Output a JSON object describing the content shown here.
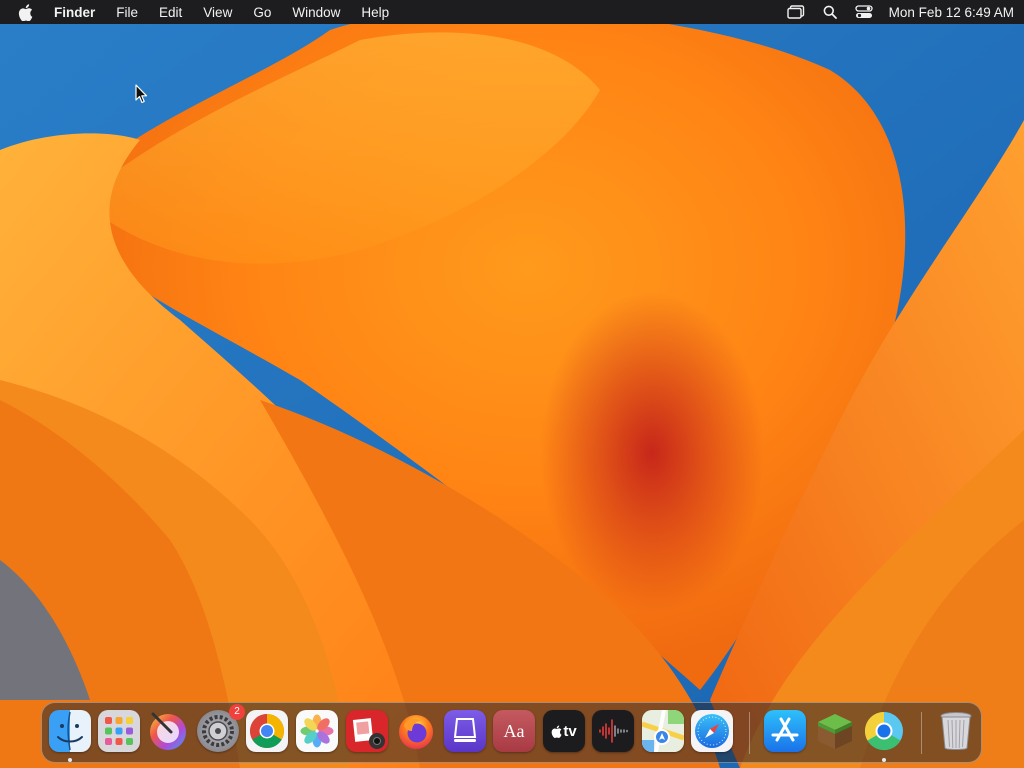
{
  "menubar": {
    "apple_icon": "apple-logo-icon",
    "items": [
      {
        "label": "Finder",
        "bold": true
      },
      {
        "label": "File"
      },
      {
        "label": "Edit"
      },
      {
        "label": "View"
      },
      {
        "label": "Go"
      },
      {
        "label": "Window"
      },
      {
        "label": "Help"
      }
    ],
    "status_icons": [
      "stage-manager-icon",
      "spotlight-search-icon",
      "control-center-icon"
    ],
    "clock": "Mon Feb 12  6:49 AM"
  },
  "desktop": {
    "wallpaper": "macOS Ventura orange petals",
    "colors": {
      "sky": "#1f74c2",
      "petal_light": "#ffb43a",
      "petal_mid": "#ff8a1c",
      "petal_deep": "#d2321a"
    }
  },
  "dock": {
    "apps": [
      {
        "name": "Finder",
        "icon": "finder-icon",
        "running": true
      },
      {
        "name": "Launchpad",
        "icon": "launchpad-icon",
        "running": false
      },
      {
        "name": "Pixelmator Pro",
        "icon": "pixelmator-icon",
        "running": false
      },
      {
        "name": "System Settings",
        "icon": "system-settings-icon",
        "running": false,
        "badge": "2"
      },
      {
        "name": "Google Chrome",
        "icon": "chrome-icon",
        "running": false
      },
      {
        "name": "Photos",
        "icon": "photos-icon",
        "running": false
      },
      {
        "name": "Photo Booth",
        "icon": "photo-booth-icon",
        "running": false
      },
      {
        "name": "Firefox",
        "icon": "firefox-icon",
        "running": false
      },
      {
        "name": "Apple Configurator",
        "icon": "configurator-icon",
        "running": false
      },
      {
        "name": "Dictionary",
        "icon": "dictionary-icon",
        "running": false,
        "label": "Aa"
      },
      {
        "name": "Apple TV",
        "icon": "apple-tv-icon",
        "running": false,
        "label": "tv"
      },
      {
        "name": "Voice Memos",
        "icon": "voice-memos-icon",
        "running": false
      },
      {
        "name": "Maps",
        "icon": "maps-icon",
        "running": false
      },
      {
        "name": "Safari",
        "icon": "safari-icon",
        "running": false
      },
      {
        "name": "App Store",
        "icon": "app-store-icon",
        "running": false
      },
      {
        "name": "Minecraft",
        "icon": "minecraft-icon",
        "running": false
      },
      {
        "name": "Chrome Beta",
        "icon": "chrome-beta-icon",
        "running": true
      },
      {
        "name": "Trash",
        "icon": "trash-icon",
        "running": false
      }
    ]
  }
}
